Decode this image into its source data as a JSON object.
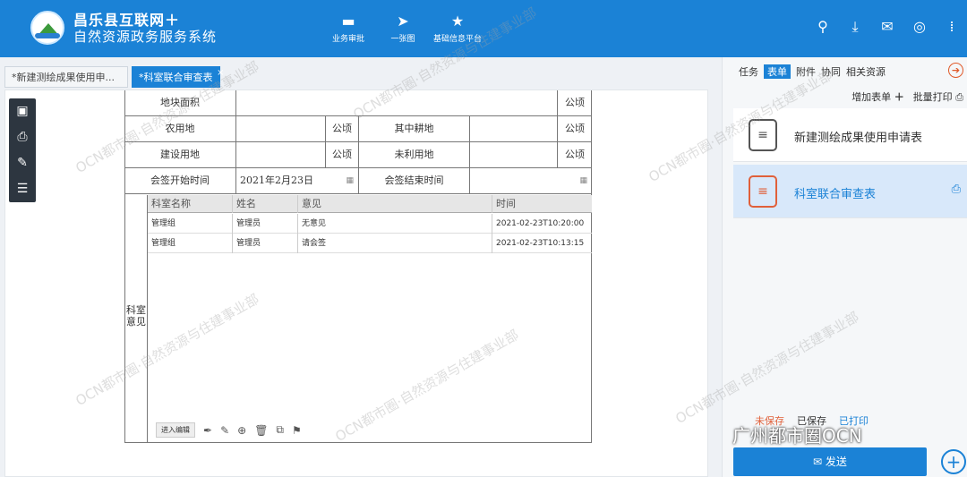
{
  "header": {
    "title_line1": "昌乐县互联网＋",
    "title_line2": "自然资源政务服务系统",
    "nav": [
      {
        "label": "业务审批",
        "icon": "folder-icon"
      },
      {
        "label": "一张图",
        "icon": "send-icon"
      },
      {
        "label": "基础信息平台",
        "icon": "star-icon"
      }
    ],
    "right_icons": [
      "search-icon",
      "download-icon",
      "mail-icon",
      "user-icon",
      "grid-icon"
    ]
  },
  "tabs": [
    {
      "label": "*新建测绘成果使用申..."
    },
    {
      "label": "*科室联合审查表"
    }
  ],
  "form": {
    "rows": [
      {
        "label": "地块面积",
        "unit": "公顷"
      },
      {
        "label": "农用地",
        "unit_left": "公顷",
        "label2": "其中耕地",
        "unit_right": "公顷"
      },
      {
        "label": "建设用地",
        "unit_left": "公顷",
        "label2": "未利用地",
        "unit_right": "公顷"
      },
      {
        "label": "会签开始时间",
        "value": "2021年2月23日",
        "label2": "会签结束时间"
      }
    ],
    "side_label": "科室\n意见",
    "opinion_headers": [
      "科室名称",
      "姓名",
      "意见",
      "时间"
    ],
    "opinions": [
      {
        "dept": "管理组",
        "name": "管理员",
        "opinion": "无意见",
        "time": "2021-02-23T10:20:00"
      },
      {
        "dept": "管理组",
        "name": "管理员",
        "opinion": "请会签",
        "time": "2021-02-23T10:13:15"
      }
    ],
    "edit_button": "进入编辑"
  },
  "right_panel": {
    "tabs": [
      "任务",
      "表单",
      "附件",
      "协同",
      "相关资源"
    ],
    "add_form": "增加表单",
    "batch_print": "批量打印",
    "cards": [
      {
        "label": "新建测绘成果使用申请表"
      },
      {
        "label": "科室联合审查表"
      }
    ],
    "legend": [
      "未保存",
      "已保存",
      "已打印"
    ],
    "send": "发送"
  },
  "watermark": "OCN都市圈·自然资源与住建事业部",
  "brand": "广州都市圈OCN"
}
